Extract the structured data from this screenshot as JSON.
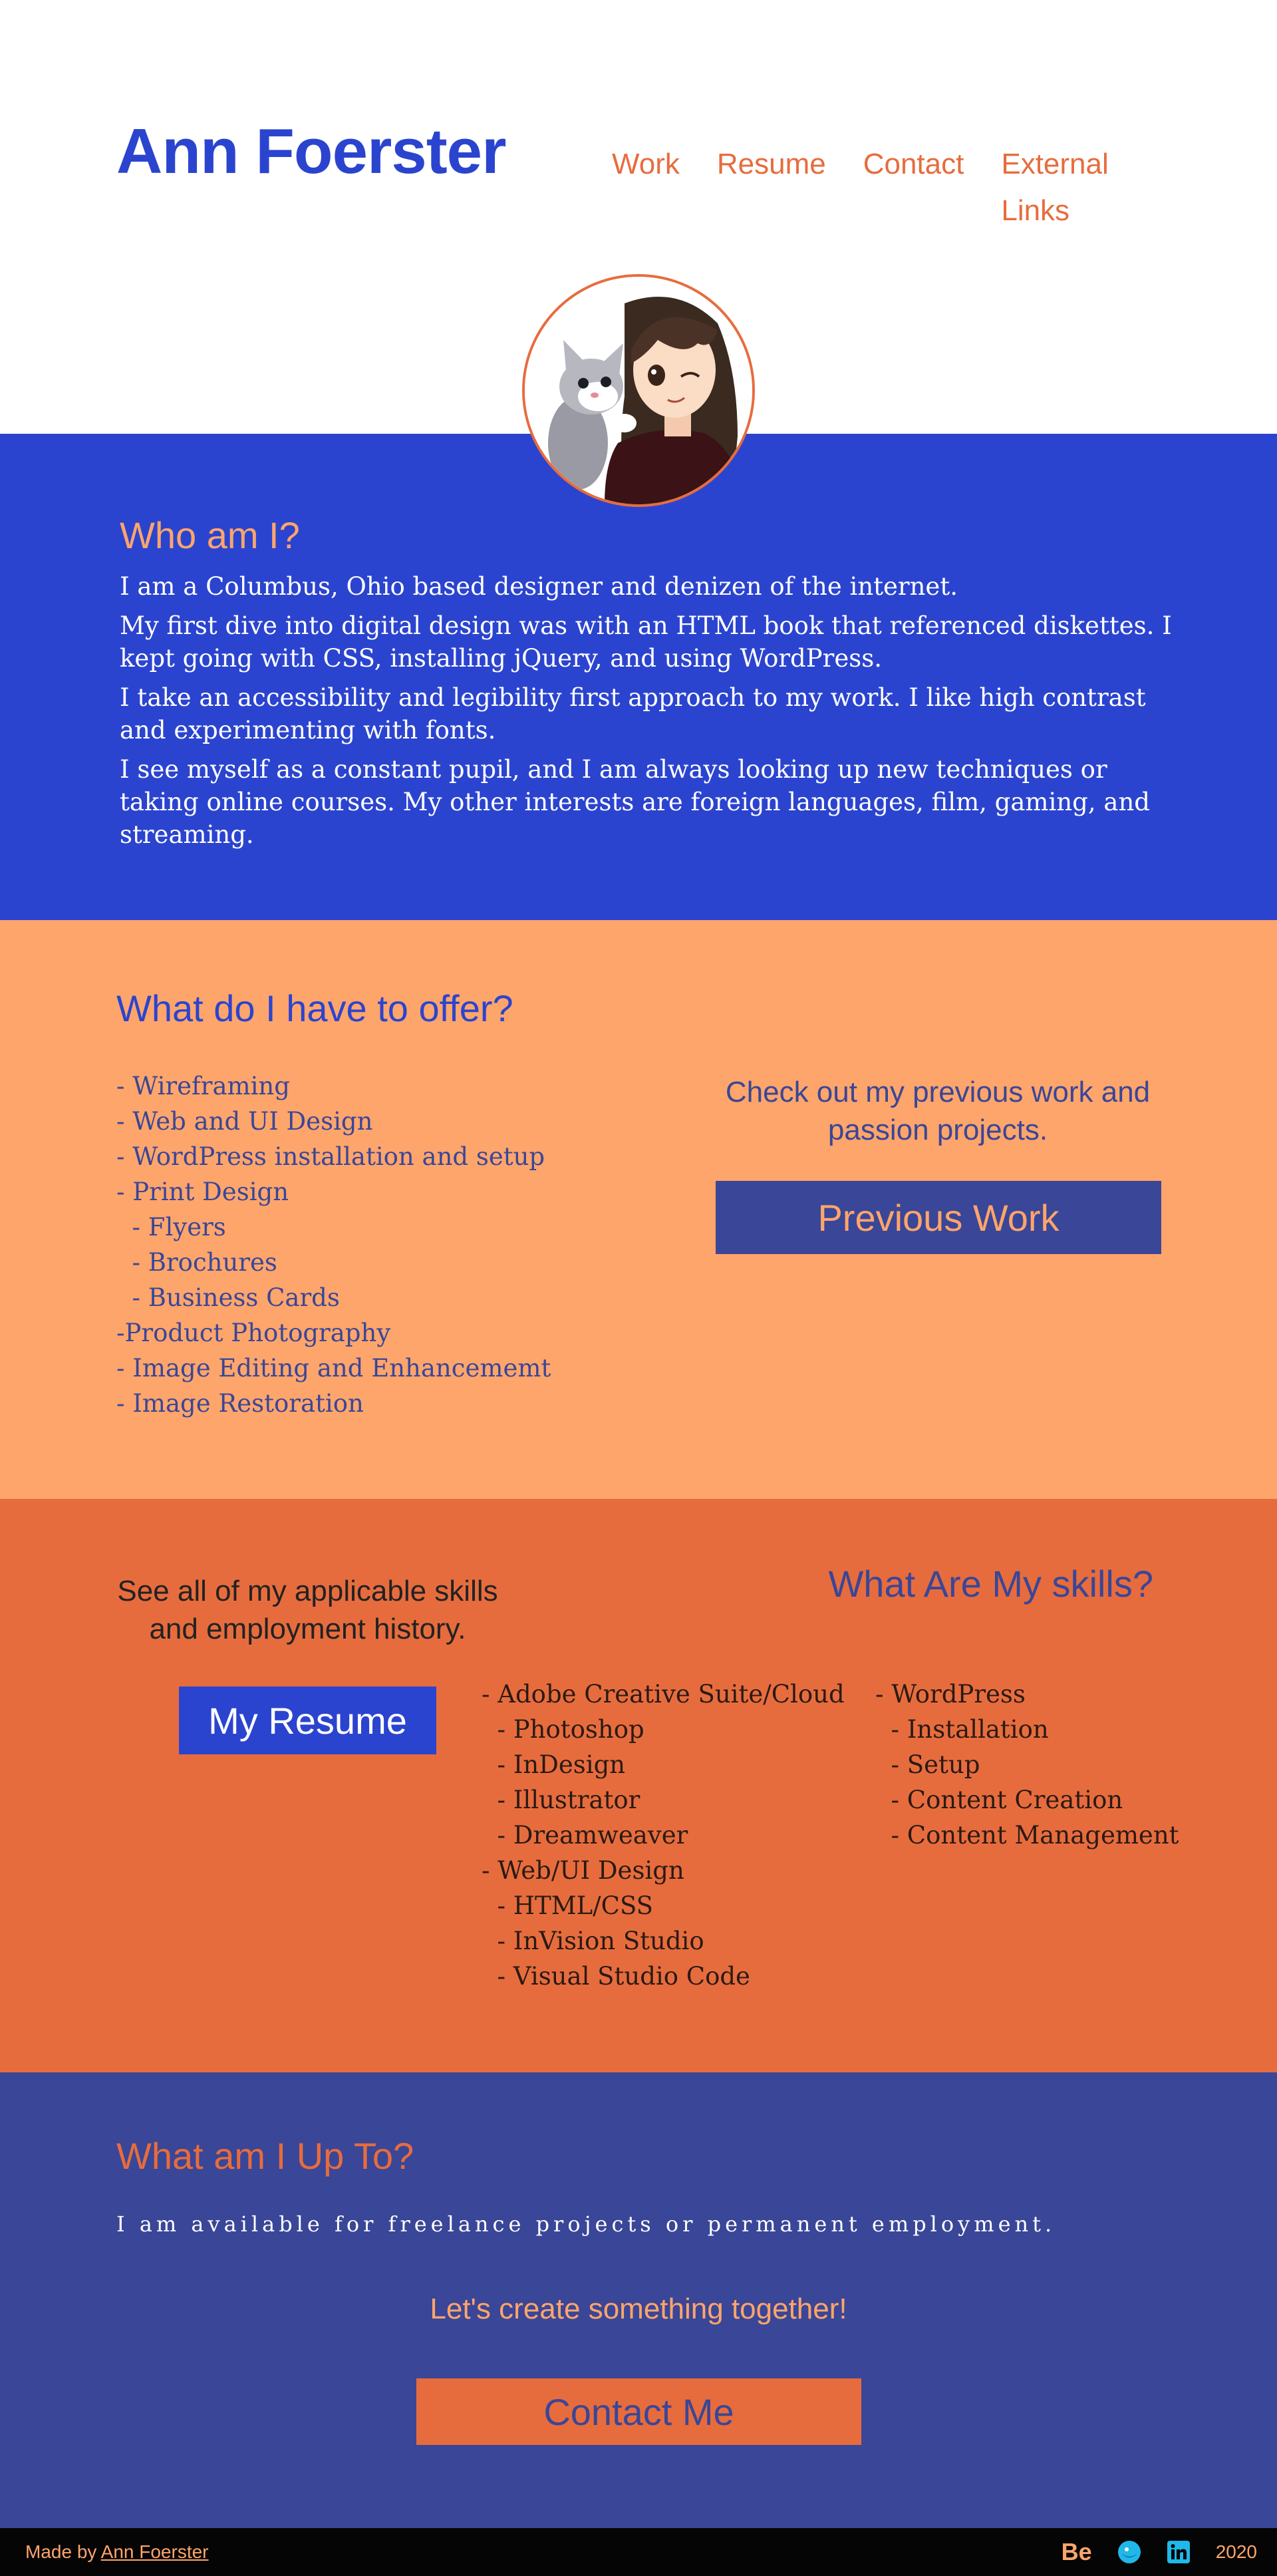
{
  "header": {
    "title": "Ann Foerster",
    "nav": [
      "Work",
      "Resume",
      "Contact",
      "External Links"
    ]
  },
  "about": {
    "heading": "Who am I?",
    "paragraphs": [
      "I am a Columbus, Ohio based designer and denizen of the internet.",
      "My first dive into digital design was with an HTML book that referenced diskettes.  I kept going with CSS, installing jQuery, and using WordPress.",
      "I take an accessibility and legibility first approach to my work.  I like high contrast and experimenting with fonts.",
      "I see myself as a constant pupil, and I am always looking up new techniques or taking online courses.  My other interests are foreign languages, film, gaming, and streaming."
    ]
  },
  "offer": {
    "heading": "What do I have to offer?",
    "items": [
      "- Wireframing",
      "- Web and UI Design",
      "- WordPress installation and setup",
      "- Print Design",
      "  - Flyers",
      "  - Brochures",
      "  - Business Cards",
      "-Product Photography",
      "- Image Editing and Enhancememt",
      "- Image Restoration"
    ],
    "cta": "Check out my previous work and passion projects.",
    "button": "Previous Work"
  },
  "skills": {
    "cta": "See all of my applicable skills and employment history.",
    "button": "My Resume",
    "heading": "What Are My skills?",
    "col1": [
      "- Adobe Creative Suite/Cloud",
      "  - Photoshop",
      "  - InDesign",
      "  - Illustrator",
      "  - Dreamweaver",
      "- Web/UI Design",
      "  - HTML/CSS",
      "  - InVision Studio",
      "  - Visual Studio Code"
    ],
    "col2": [
      "- WordPress",
      "  - Installation",
      "  - Setup",
      "  - Content Creation",
      "  - Content Management"
    ]
  },
  "upto": {
    "heading": "What am I Up To?",
    "text": "I am available for freelance projects or permanent employment.",
    "cta": "Let's create something together!",
    "button": "Contact Me"
  },
  "footer": {
    "made_by": "Made by",
    "author": "Ann Foerster",
    "behance": "Be",
    "year": "2020"
  },
  "colors": {
    "blue": "#2b44cf",
    "navy": "#3a4697",
    "peach": "#fea56b",
    "orange": "#e76c3d",
    "black": "#050505"
  },
  "icons": [
    "behance-icon",
    "website-icon",
    "linkedin-icon"
  ]
}
